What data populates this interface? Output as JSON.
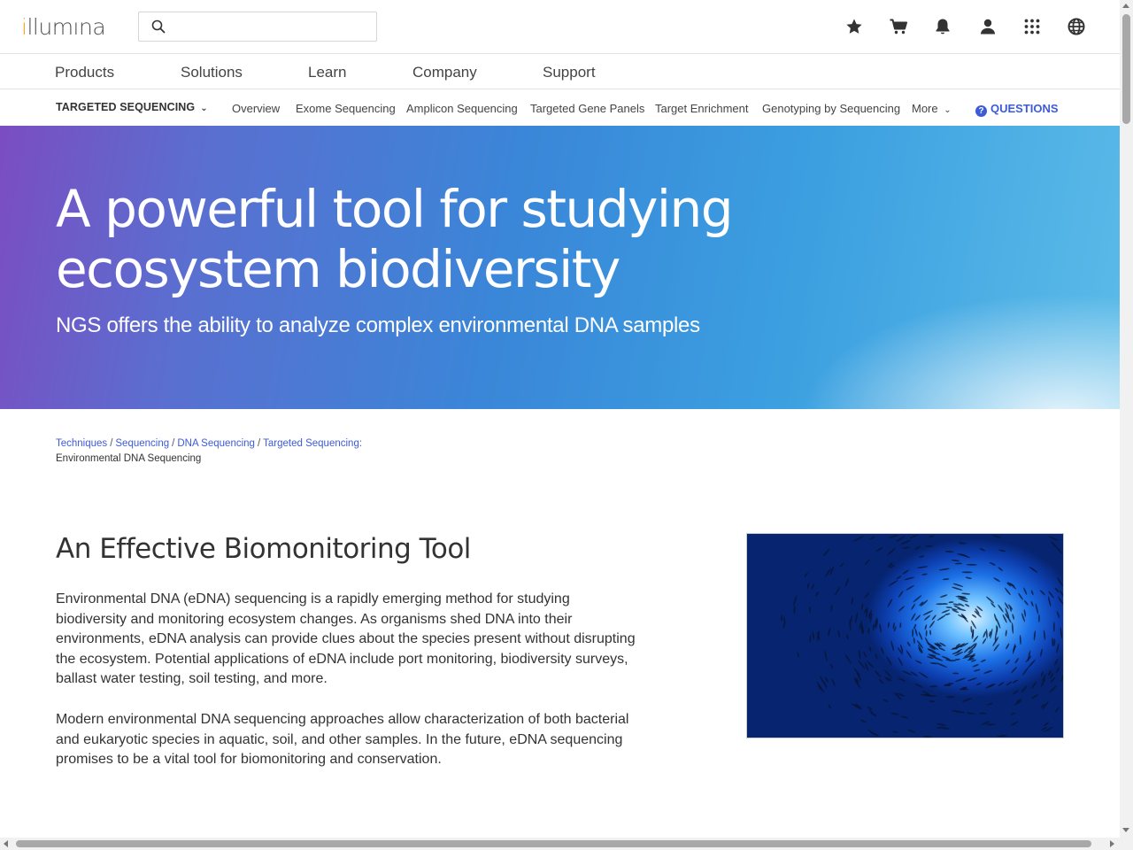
{
  "header": {
    "logo_text": "illumina",
    "search": {
      "placeholder": "",
      "value": ""
    },
    "icons": [
      "star-icon",
      "cart-icon",
      "bell-icon",
      "user-icon",
      "apps-grid-icon",
      "globe-icon"
    ]
  },
  "main_nav": {
    "items": [
      "Products",
      "Solutions",
      "Learn",
      "Company",
      "Support"
    ]
  },
  "sub_nav": {
    "section_label": "TARGETED SEQUENCING",
    "links": [
      "Overview",
      "Exome Sequencing",
      "Amplicon Sequencing",
      "Targeted Gene Panels",
      "Target Enrichment",
      "Genotyping by Sequencing"
    ],
    "more_label": "More",
    "questions_label": "QUESTIONS"
  },
  "hero": {
    "title": "A powerful tool for studying ecosystem biodiversity",
    "subtitle": "NGS offers the ability to analyze complex environmental DNA samples"
  },
  "breadcrumb": {
    "links": [
      "Techniques",
      "Sequencing",
      "DNA Sequencing",
      "Targeted Sequencing:"
    ],
    "current": "Environmental DNA Sequencing"
  },
  "content": {
    "title": "An Effective Biomonitoring Tool",
    "paragraph1": "Environmental DNA (eDNA) sequencing is a rapidly emerging method for studying biodiversity and monitoring ecosystem changes. As organisms shed DNA into their environments, eDNA analysis can provide clues about the species present without disrupting the ecosystem. Potential applications of eDNA include port monitoring, biodiversity surveys, ballast water testing, soil testing, and more.",
    "paragraph2": "Modern environmental DNA sequencing approaches allow characterization of both bacterial and eukaryotic species in aquatic, soil, and other samples. In the future, eDNA sequencing promises to be a vital tool for biomonitoring and conservation."
  },
  "colors": {
    "accent_link": "#3d5bd8",
    "logo_accent": "#f7a31c",
    "hero_gradient_start": "#7b4dc2",
    "hero_gradient_end": "#5bbbe8"
  }
}
